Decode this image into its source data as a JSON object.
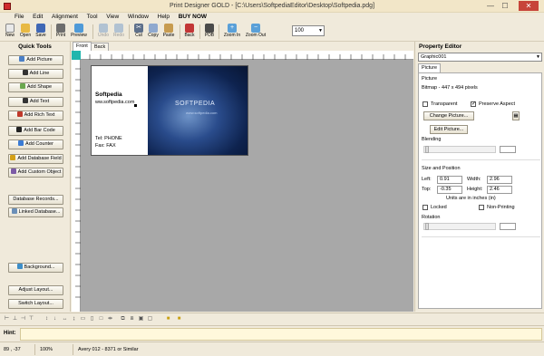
{
  "window": {
    "title": "Print Designer GOLD  -  [C:\\Users\\SoftpediaEditor\\Desktop\\Softpedia.pdg]",
    "min": "—",
    "max": "☐",
    "close": "✕"
  },
  "menu": [
    "File",
    "Edit",
    "Alignment",
    "Tool",
    "View",
    "Window",
    "Help",
    "BUY NOW"
  ],
  "toolbar": {
    "new": "New",
    "open": "Open",
    "save": "Save",
    "print": "Print",
    "preview": "Preview",
    "undo": "Undo",
    "redo": "Redo",
    "cut": "Cut",
    "copy": "Copy",
    "paste": "Paste",
    "back": "Back",
    "pdb": "PDB",
    "zoom_in": "Zoom In",
    "zoom_out": "Zoom Out",
    "zoom_value": "100"
  },
  "quick_tools": {
    "title": "Quick Tools",
    "buttons": [
      "Add Picture",
      "Add Line",
      "Add Shape",
      "Add Text",
      "Add Rich Text",
      "Add Bar Code",
      "Add Counter",
      "Add Database Field",
      "Add Custom Object",
      "Database Records...",
      "Linked Database...",
      "Background...",
      "Adjust Layout...",
      "Switch Layout..."
    ]
  },
  "canvas": {
    "tabs": [
      "Front",
      "Back"
    ],
    "card": {
      "name": "Softpedia",
      "web": "ww.softpedia.com",
      "tel": "Tel:  PHONE",
      "fax": "Fax:  FAX",
      "logo": "SOFTPEDIA",
      "logo_sub": "www.softpedia.com"
    }
  },
  "property_editor": {
    "title": "Property Editor",
    "object": "Graphic001",
    "tab": "Picture",
    "picture_label": "Picture",
    "bitmap_info": "Bitmap - 447 x 494 pixels",
    "transparent": "Transparent",
    "preserve_aspect": "Preserve Aspect",
    "change_picture": "Change Picture...",
    "edit_picture": "Edit Picture...",
    "blending": "Blending",
    "size_position": "Size and Position",
    "left_label": "Left:",
    "left_value": "0.91",
    "width_label": "Width:",
    "width_value": "2.96",
    "top_label": "Top:",
    "top_value": "-0.35",
    "height_label": "Height:",
    "height_value": "2.46",
    "units_note": "Units are in inches (in)",
    "locked": "Locked",
    "non_printing": "Non-Printing",
    "rotation": "Rotation"
  },
  "hint": {
    "label": "Hint:",
    "text": ""
  },
  "status": {
    "coords": "89 , -37",
    "zoom": "100%",
    "layout": "Avery 012 - 8371 or Similar"
  },
  "colors": {
    "accent": "#20b6ad",
    "title_bg": "#f2e6c8",
    "close": "#c7443a"
  }
}
